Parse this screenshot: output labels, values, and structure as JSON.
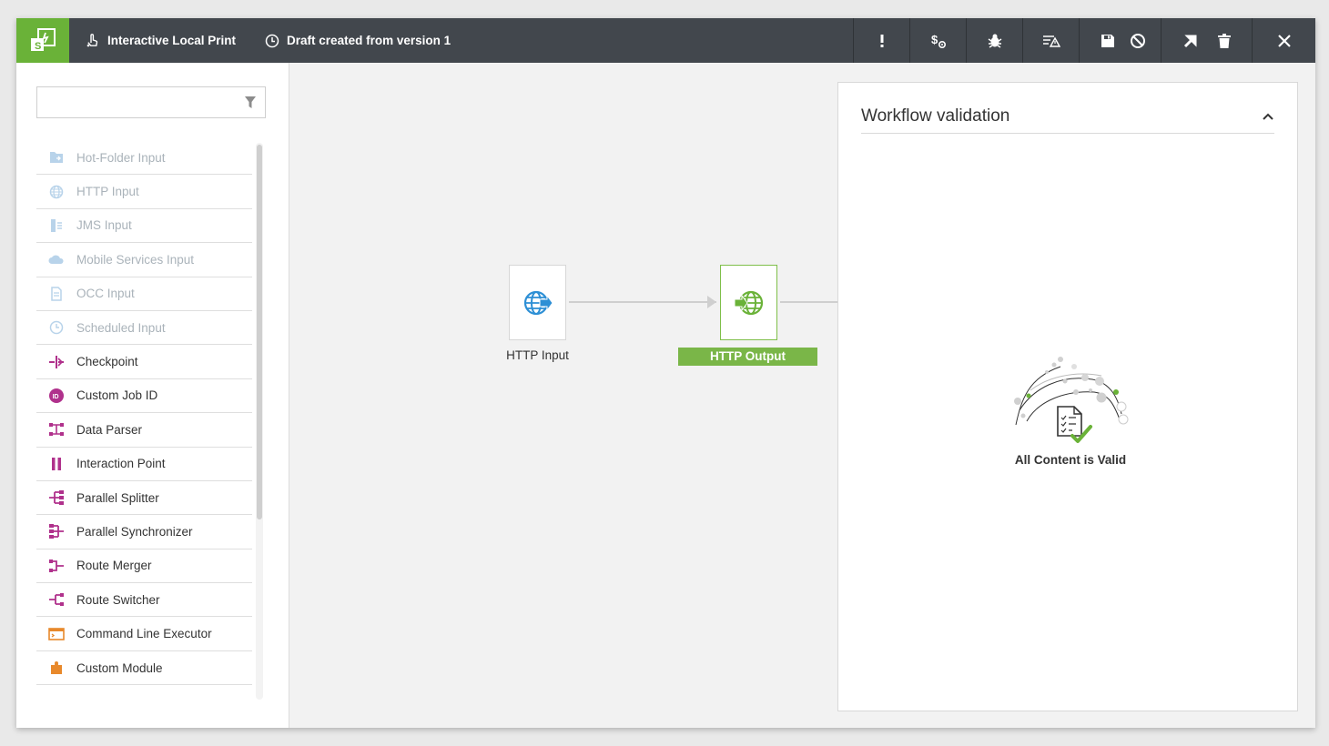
{
  "header": {
    "workflow_name": "Interactive Local Print",
    "draft_status": "Draft created from version 1",
    "icons": [
      "app-logo-icon",
      "hand-pointer-icon",
      "clock-icon",
      "exclamation-icon",
      "dollar-settings-icon",
      "bug-icon",
      "list-warning-icon",
      "save-icon",
      "ban-icon",
      "export-arrow-icon",
      "trash-icon",
      "close-icon"
    ]
  },
  "sidebar": {
    "search_placeholder": "",
    "items": [
      {
        "label": "Hot-Folder Input",
        "enabled": false,
        "icon": "folder-input-icon"
      },
      {
        "label": "HTTP Input",
        "enabled": false,
        "icon": "globe-icon"
      },
      {
        "label": "JMS Input",
        "enabled": false,
        "icon": "jms-icon"
      },
      {
        "label": "Mobile Services Input",
        "enabled": false,
        "icon": "cloud-icon"
      },
      {
        "label": "OCC Input",
        "enabled": false,
        "icon": "document-icon"
      },
      {
        "label": "Scheduled Input",
        "enabled": false,
        "icon": "clock-icon"
      },
      {
        "label": "Checkpoint",
        "enabled": true,
        "icon": "checkpoint-icon"
      },
      {
        "label": "Custom Job ID",
        "enabled": true,
        "icon": "id-badge-icon"
      },
      {
        "label": "Data Parser",
        "enabled": true,
        "icon": "data-parser-icon"
      },
      {
        "label": "Interaction Point",
        "enabled": true,
        "icon": "pause-icon"
      },
      {
        "label": "Parallel Splitter",
        "enabled": true,
        "icon": "splitter-icon"
      },
      {
        "label": "Parallel Synchronizer",
        "enabled": true,
        "icon": "synchronizer-icon"
      },
      {
        "label": "Route Merger",
        "enabled": true,
        "icon": "route-merger-icon"
      },
      {
        "label": "Route Switcher",
        "enabled": true,
        "icon": "route-switcher-icon"
      },
      {
        "label": "Command Line Executor",
        "enabled": true,
        "icon": "terminal-icon"
      },
      {
        "label": "Custom Module",
        "enabled": true,
        "icon": "puzzle-icon"
      }
    ]
  },
  "canvas": {
    "nodes": [
      {
        "label": "HTTP Input",
        "selected": false
      },
      {
        "label": "HTTP Output",
        "selected": true
      }
    ]
  },
  "validation": {
    "title": "Workflow validation",
    "status": "All Content is Valid"
  },
  "colors": {
    "topbar": "#42474d",
    "brand_green": "#6ab238",
    "magenta": "#b0318c",
    "orange": "#e8892b",
    "disabled_icon": "#b8d3ea",
    "http_blue": "#2d8fd5"
  }
}
